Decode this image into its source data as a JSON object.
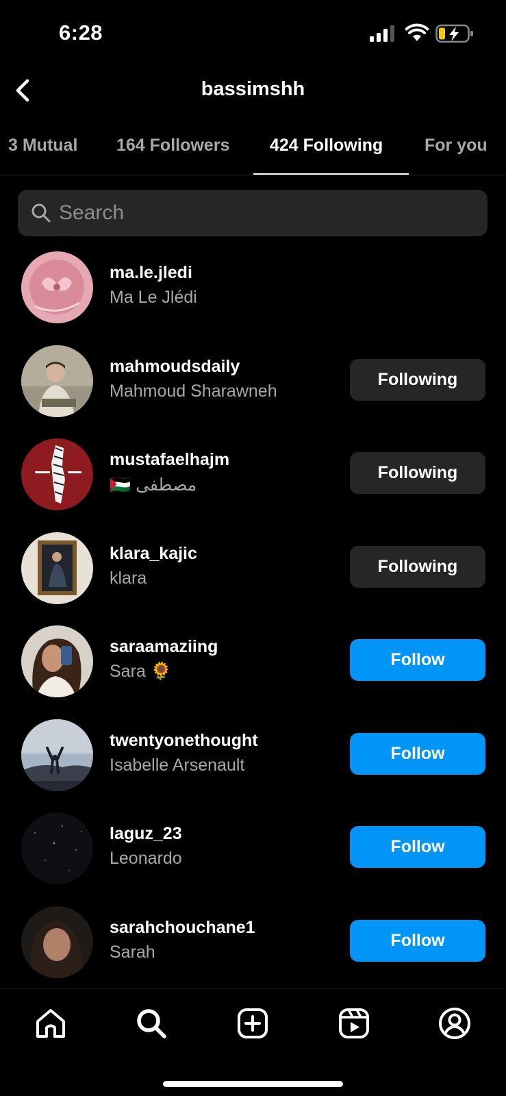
{
  "status_bar": {
    "time": "6:28",
    "icons": [
      "cellular-signal-icon",
      "wifi-icon",
      "battery-charging-icon"
    ],
    "battery_color": "#f5c518"
  },
  "header": {
    "title": "bassimshh",
    "back_icon": "chevron-left-icon"
  },
  "tabs": [
    {
      "label": "3 Mutual",
      "active": false
    },
    {
      "label": "164 Followers",
      "active": false
    },
    {
      "label": "424 Following",
      "active": true
    },
    {
      "label": "For you",
      "active": false
    }
  ],
  "search": {
    "placeholder": "Search",
    "value": ""
  },
  "accounts": [
    {
      "username": "ma.le.jledi",
      "full_name": "Ma Le Jlédi",
      "button": ""
    },
    {
      "username": "mahmoudsdaily",
      "full_name": "Mahmoud Sharawneh",
      "button": "Following"
    },
    {
      "username": "mustafaelhajm",
      "full_name": "🇵🇸 مصطفى",
      "button": "Following"
    },
    {
      "username": "klara_kajic",
      "full_name": "klara",
      "button": "Following"
    },
    {
      "username": "saraamaziing",
      "full_name": "Sara 🌻",
      "button": "Follow"
    },
    {
      "username": "twentyonethought",
      "full_name": "Isabelle Arsenault",
      "button": "Follow"
    },
    {
      "username": "laguz_23",
      "full_name": "Leonardo",
      "button": "Follow"
    },
    {
      "username": "sarahchouchane1",
      "full_name": "Sarah",
      "button": "Follow"
    }
  ],
  "bottom_nav": [
    {
      "name": "home-icon"
    },
    {
      "name": "search-icon"
    },
    {
      "name": "create-post-icon"
    },
    {
      "name": "reels-icon"
    },
    {
      "name": "profile-icon"
    }
  ],
  "colors": {
    "background": "#000000",
    "follow_button": "#0095f6",
    "following_button": "#262626",
    "secondary_text": "#a8a8a8"
  }
}
